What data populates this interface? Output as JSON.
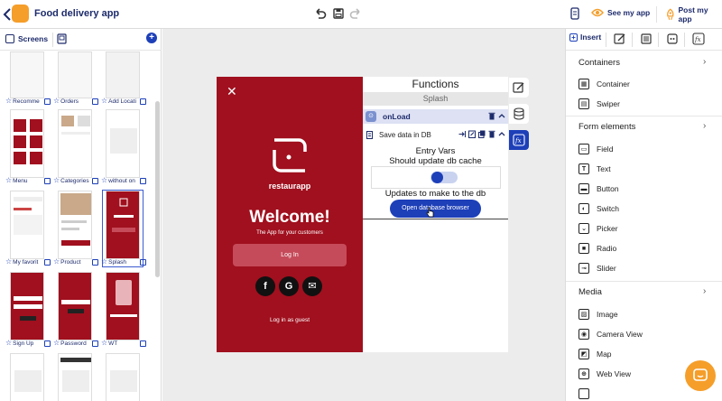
{
  "app": {
    "title": "Food delivery app",
    "brand_color": "#f59e2a"
  },
  "toolbar": {
    "see_app": "See my app",
    "post_app": "Post my app"
  },
  "screens_panel": {
    "title": "Screens",
    "rows": [
      [
        "Recomme",
        "Orders",
        "Add Locati"
      ],
      [
        "Menu",
        "Categories",
        "without on"
      ],
      [
        "My favorit",
        "Product",
        "Splash"
      ],
      [
        "Sign Up",
        "Password",
        "WT"
      ]
    ],
    "selected": "Splash"
  },
  "phone": {
    "brand_name": "restaurapp",
    "welcome": "Welcome!",
    "subtitle": "The App for your customers",
    "login_button": "Log In",
    "social_buttons": [
      "f",
      "G",
      "✉"
    ],
    "guest_link": "Log in as guest",
    "background_color": "#a0101e"
  },
  "functions": {
    "title": "Functions",
    "screen_name": "Splash",
    "event": "onLoad",
    "action": "Save data in DB",
    "entry_vars_title": "Entry Vars",
    "entry_var_label": "Should update db cache",
    "toggle_value": false,
    "updates_label": "Updates to make to the db",
    "open_db_button": "Open database browser"
  },
  "right_panel": {
    "tab_insert": "Insert",
    "sections": [
      {
        "title": "Containers",
        "items": [
          "Container",
          "Swiper"
        ]
      },
      {
        "title": "Form elements",
        "items": [
          "Field",
          "Text",
          "Button",
          "Switch",
          "Picker",
          "Radio",
          "Slider"
        ]
      },
      {
        "title": "Media",
        "items": [
          "Image",
          "Camera View",
          "Map",
          "Web View"
        ]
      }
    ]
  }
}
